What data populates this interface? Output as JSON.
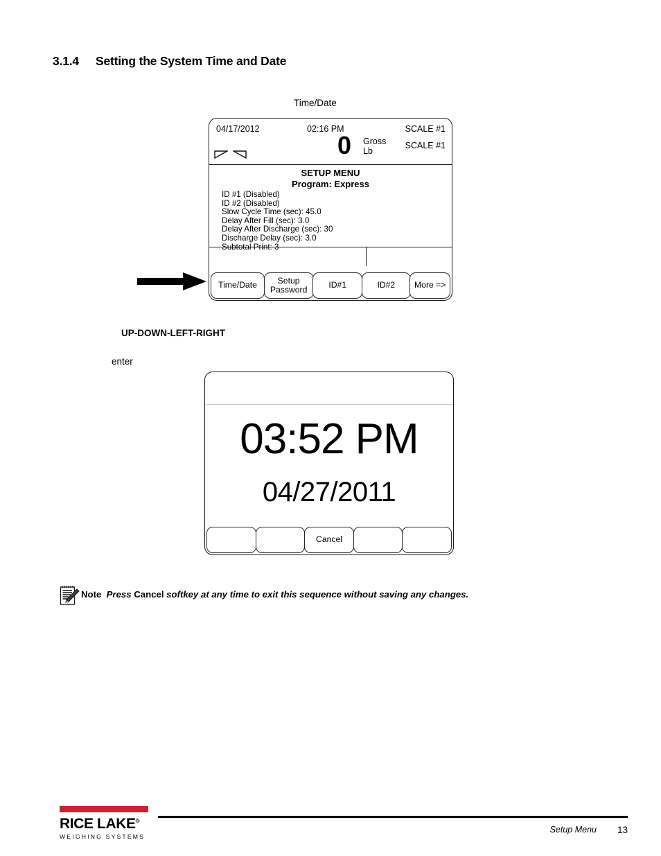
{
  "section": {
    "number": "3.1.4",
    "title": "Setting the System Time and Date"
  },
  "caption": {
    "time_date": "Time/Date"
  },
  "indicator_panel": {
    "weight_header": {
      "date": "04/17/2012",
      "time": "02:16 PM",
      "scale_top": "SCALE #1",
      "scale_second": "SCALE #1",
      "weight_value": "0",
      "mode": "Gross",
      "units": "Lb",
      "annunciators": [
        "center-of-zero-triangle",
        "standstill-triangle"
      ]
    },
    "menu": {
      "title": "SETUP MENU",
      "subtitle": "Program: Express",
      "items": [
        "ID #1 (Disabled)",
        "ID #2 (Disabled)",
        "Slow Cycle Time (sec): 45.0",
        "Delay After Fill (sec): 3.0",
        "Delay After Discharge (sec): 30",
        "Discharge Delay (sec): 3.0",
        "Subtotal Print: 3"
      ]
    },
    "softkeys": [
      {
        "label": "Time/Date",
        "key": "k-time"
      },
      {
        "label": "Setup\nPassword",
        "line1": "Setup",
        "line2": "Password",
        "key": "k-pass"
      },
      {
        "label": "ID#1",
        "key": "k-id1"
      },
      {
        "label": "ID#2",
        "key": "k-id2"
      },
      {
        "label": "More =>",
        "key": "k-more"
      }
    ]
  },
  "callouts": {
    "pointer_arrow": "arrow pointing to Time/Date softkey",
    "up_down_left_right": "UP-DOWN-LEFT-RIGHT",
    "enter": "enter"
  },
  "time_date_panel": {
    "time": "03:52 PM",
    "date": "04/27/2011",
    "softkeys": [
      {
        "label": ""
      },
      {
        "label": ""
      },
      {
        "label": "Cancel"
      },
      {
        "label": ""
      },
      {
        "label": ""
      }
    ]
  },
  "note": {
    "label": "Note",
    "part1": "Press",
    "part2": "Cancel",
    "part3": "softkey at any time to exit this sequence without saving any changes."
  },
  "footer": {
    "logo_name_1": "RICE",
    "logo_name_2": "LAKE",
    "logo_tagline": "WEIGHING SYSTEMS",
    "section_name": "Setup Menu",
    "page_number": "13"
  },
  "colors": {
    "brand_red": "#cf2030",
    "ink": "#000000",
    "panel_border": "#1a1a1a"
  }
}
